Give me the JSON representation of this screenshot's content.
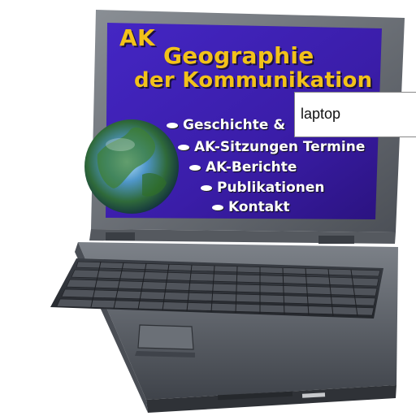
{
  "screen": {
    "brand": {
      "line1": "AK",
      "line2": "Geographie",
      "line3": "der Kommunikation"
    },
    "menu": [
      {
        "label": "Geschichte &"
      },
      {
        "label": "AK-Sitzungen Termine"
      },
      {
        "label": "AK-Berichte"
      },
      {
        "label": "Publikationen"
      },
      {
        "label": "Kontakt"
      }
    ]
  },
  "annotation": {
    "label": "laptop"
  },
  "icons": [
    "laptop-icon",
    "globe-icon",
    "bullet-icon"
  ],
  "colors": {
    "screen_bg": "#3b1fb0",
    "brand_text": "#f2c21a",
    "menu_text": "#ffffff",
    "laptop_body": "#5a5f66"
  }
}
